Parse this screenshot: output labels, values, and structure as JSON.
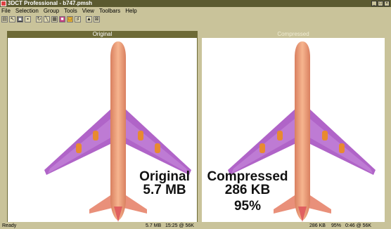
{
  "window": {
    "title": "3DCT Professional - b747.pmsh",
    "controls": [
      "_",
      "□",
      "×"
    ]
  },
  "menubar": [
    {
      "label": "File"
    },
    {
      "label": "Selection"
    },
    {
      "label": "Group"
    },
    {
      "label": "Tools"
    },
    {
      "label": "View"
    },
    {
      "label": "Toolbars"
    },
    {
      "label": "Help"
    }
  ],
  "toolbar": {
    "icons": [
      "open-icon",
      "select-icon",
      "compress-icon",
      "save-icon",
      "rotate-icon",
      "line-icon",
      "grid-icon",
      "color-icon",
      "wire-icon",
      "mesh-icon",
      "flat-icon",
      "compare-icon"
    ]
  },
  "panels": {
    "left": {
      "header": "Original",
      "label_line1": "Original",
      "label_line2": "5.7 MB"
    },
    "right": {
      "header": "Compressed",
      "label_line1": "Compressed",
      "label_line2": "286 KB",
      "label_line3": "95%"
    }
  },
  "colors": {
    "fuselage": "#f2a07a",
    "wing": "#b064c8",
    "tail_tip": "#e06060",
    "engine": "#e88a30"
  },
  "statusbar": {
    "ready": "Ready",
    "left_size": "5.7 MB",
    "left_time": "15:25 @ 56K",
    "right_size": "286 KB",
    "right_pct": "95%",
    "right_time": "0:46 @ 56K"
  }
}
